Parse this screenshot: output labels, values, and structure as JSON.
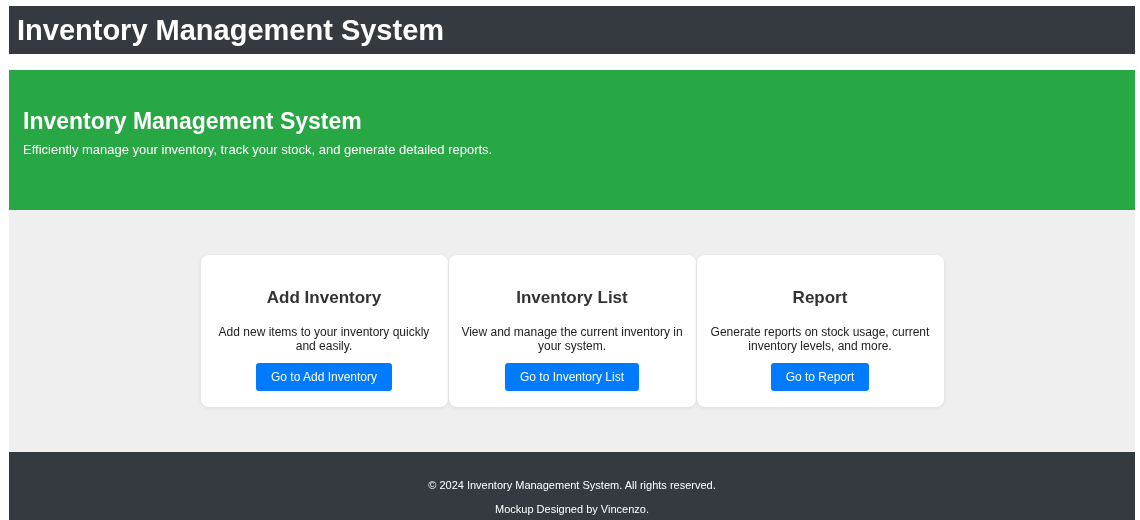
{
  "header": {
    "title": "Inventory Management System"
  },
  "hero": {
    "title": "Inventory Management System",
    "subtitle": "Efficiently manage your inventory, track your stock, and generate detailed reports."
  },
  "cards": [
    {
      "title": "Add Inventory",
      "description": "Add new items to your inventory quickly and easily.",
      "button": "Go to Add Inventory"
    },
    {
      "title": "Inventory List",
      "description": "View and manage the current inventory in your system.",
      "button": "Go to Inventory List"
    },
    {
      "title": "Report",
      "description": "Generate reports on stock usage, current inventory levels, and more.",
      "button": "Go to Report"
    }
  ],
  "footer": {
    "copyright": "© 2024 Inventory Management System. All rights reserved.",
    "credit": "Mockup Designed by Vincenzo."
  }
}
